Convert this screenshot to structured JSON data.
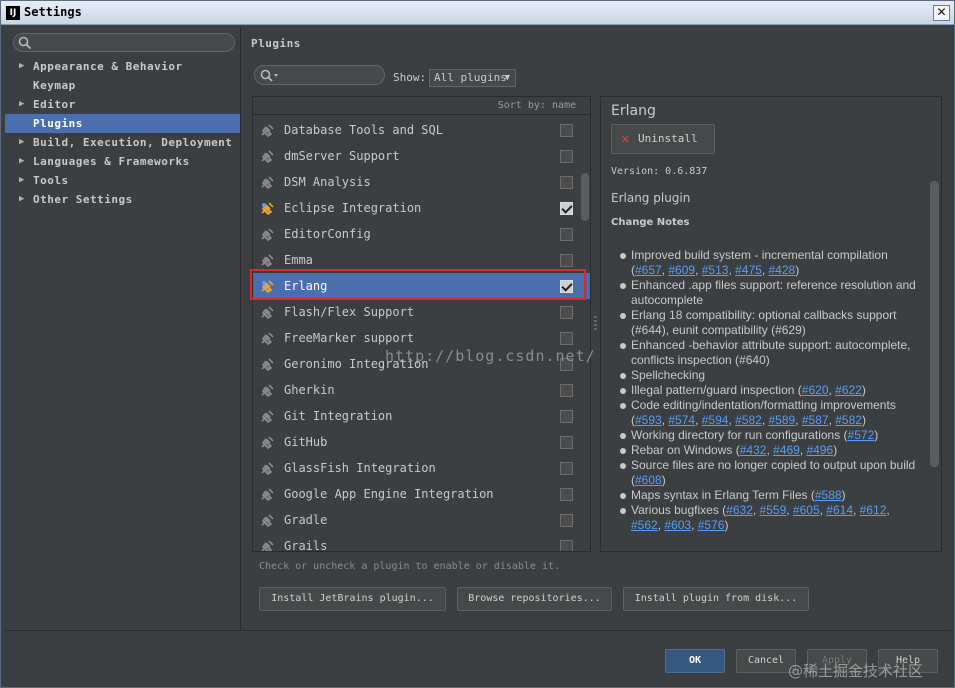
{
  "window": {
    "title": "Settings",
    "app_icon": "IJ",
    "close_label": "✕"
  },
  "sidebar": {
    "search_placeholder": "",
    "items": [
      {
        "label": "Appearance & Behavior",
        "expandable": true
      },
      {
        "label": "Keymap",
        "expandable": false
      },
      {
        "label": "Editor",
        "expandable": true
      },
      {
        "label": "Plugins",
        "expandable": false,
        "selected": true
      },
      {
        "label": "Build, Execution, Deployment",
        "expandable": true
      },
      {
        "label": "Languages & Frameworks",
        "expandable": true
      },
      {
        "label": "Tools",
        "expandable": true
      },
      {
        "label": "Other Settings",
        "expandable": true
      }
    ]
  },
  "plugins": {
    "title": "Plugins",
    "show_label": "Show:",
    "show_value": "All plugins",
    "sort_label": "Sort by: name",
    "items": [
      {
        "name": "Database Tools and SQL",
        "checked": false,
        "icon": "plug-icon"
      },
      {
        "name": "dmServer Support",
        "checked": false,
        "icon": "plug-icon"
      },
      {
        "name": "DSM Analysis",
        "checked": false,
        "icon": "plug-icon"
      },
      {
        "name": "Eclipse Integration",
        "checked": true,
        "icon": "plug-color-icon"
      },
      {
        "name": "EditorConfig",
        "checked": false,
        "icon": "plug-icon"
      },
      {
        "name": "Emma",
        "checked": false,
        "icon": "plug-icon"
      },
      {
        "name": "Erlang",
        "checked": true,
        "icon": "plug-color-icon",
        "selected": true
      },
      {
        "name": "Flash/Flex Support",
        "checked": false,
        "icon": "plug-icon"
      },
      {
        "name": "FreeMarker support",
        "checked": false,
        "icon": "plug-icon"
      },
      {
        "name": "Geronimo Integration",
        "checked": false,
        "icon": "plug-icon"
      },
      {
        "name": "Gherkin",
        "checked": false,
        "icon": "plug-icon"
      },
      {
        "name": "Git Integration",
        "checked": false,
        "icon": "plug-icon"
      },
      {
        "name": "GitHub",
        "checked": false,
        "icon": "plug-icon"
      },
      {
        "name": "GlassFish Integration",
        "checked": false,
        "icon": "plug-icon"
      },
      {
        "name": "Google App Engine Integration",
        "checked": false,
        "icon": "plug-icon"
      },
      {
        "name": "Gradle",
        "checked": false,
        "icon": "plug-icon"
      },
      {
        "name": "Grails",
        "checked": false,
        "icon": "plug-icon"
      }
    ],
    "hint": "Check or uncheck a plugin to enable or disable it.",
    "buttons": {
      "install_jetbrains": "Install JetBrains plugin...",
      "browse": "Browse repositories...",
      "install_disk": "Install plugin from disk..."
    }
  },
  "details": {
    "name": "Erlang",
    "uninstall_label": "Uninstall",
    "version": "Version: 0.6.837",
    "description": "Erlang plugin",
    "change_notes_label": "Change Notes",
    "notes": [
      {
        "text": "Improved build system - incremental compilation",
        "links": [
          "#657",
          "#609",
          "#513",
          "#475",
          "#428"
        ]
      },
      {
        "text": "Enhanced .app files support: reference resolution and autocomplete",
        "links": []
      },
      {
        "text": "Erlang 18 compatibility: optional callbacks support (#644), eunit compatibility (#629)",
        "links": []
      },
      {
        "text": "Enhanced -behavior attribute support: autocomplete, conflicts inspection (#640)",
        "links": []
      },
      {
        "text": "Spellchecking",
        "links": []
      },
      {
        "text": "Illegal pattern/guard inspection",
        "links": [
          "#620",
          "#622"
        ]
      },
      {
        "text": "Code editing/indentation/formatting improvements",
        "links": [
          "#593",
          "#574",
          "#594",
          "#582",
          "#589",
          "#587",
          "#582"
        ]
      },
      {
        "text": "Working directory for run configurations",
        "links": [
          "#572"
        ]
      },
      {
        "text": "Rebar on Windows",
        "links": [
          "#432",
          "#469",
          "#496"
        ]
      },
      {
        "text": "Source files are no longer copied to output upon build",
        "links": [
          "#608"
        ]
      },
      {
        "text": "Maps syntax in Erlang Term Files",
        "links": [
          "#588"
        ]
      },
      {
        "text": "Various bugfixes",
        "links": [
          "#632",
          "#559",
          "#605",
          "#614",
          "#612",
          "#562",
          "#603",
          "#576"
        ]
      }
    ]
  },
  "footer": {
    "ok": "OK",
    "cancel": "Cancel",
    "apply": "Apply",
    "help": "Help"
  },
  "watermarks": {
    "url": "http://blog.csdn.net/",
    "corner": "@稀土掘金技术社区"
  },
  "colors": {
    "selection": "#4b6eaf",
    "highlight_box": "#e3262a",
    "link": "#589df6",
    "background": "#3c3f41"
  }
}
